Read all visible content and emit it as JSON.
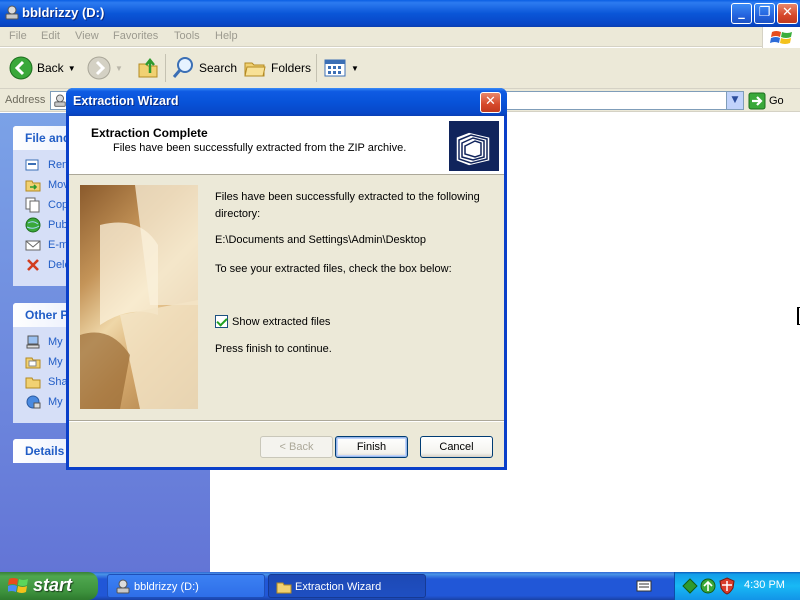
{
  "explorer": {
    "title": "bbldrizzy (D:)",
    "menu": [
      "File",
      "Edit",
      "View",
      "Favorites",
      "Tools",
      "Help"
    ],
    "toolbar": {
      "back": "Back",
      "search": "Search",
      "folders": "Folders"
    },
    "address": {
      "label": "Address",
      "go": "Go"
    },
    "task_pane": {
      "file_tasks": {
        "title": "File and",
        "items": [
          "Ren",
          "Mov",
          "Cop",
          "Pub",
          "E-m",
          "Dele"
        ]
      },
      "other_places": {
        "title": "Other P",
        "items": [
          "My",
          "My",
          "Sha",
          "My"
        ]
      },
      "details": {
        "title": "Details"
      }
    }
  },
  "dialog": {
    "title": "Extraction Wizard",
    "header_title": "Extraction Complete",
    "header_subtitle": "Files have been successfully extracted from the ZIP archive.",
    "line1": "Files have been successfully extracted to the following",
    "line2": "directory:",
    "path": "E:\\Documents and Settings\\Admin\\Desktop",
    "instruction": "To see your extracted files, check the box below:",
    "checkbox_label": "Show extracted files",
    "checkbox_checked": true,
    "continue_text": "Press finish to continue.",
    "back_label": "< Back",
    "finish_label": "Finish",
    "cancel_label": "Cancel"
  },
  "taskbar": {
    "start_label": "start",
    "tasks": [
      "bbldrizzy (D:)",
      "Extraction Wizard"
    ],
    "clock": "4:30 PM"
  },
  "colors": {
    "xp_blue": "#0853d9",
    "task_link": "#215dc6",
    "start_green": "#3d923d"
  }
}
